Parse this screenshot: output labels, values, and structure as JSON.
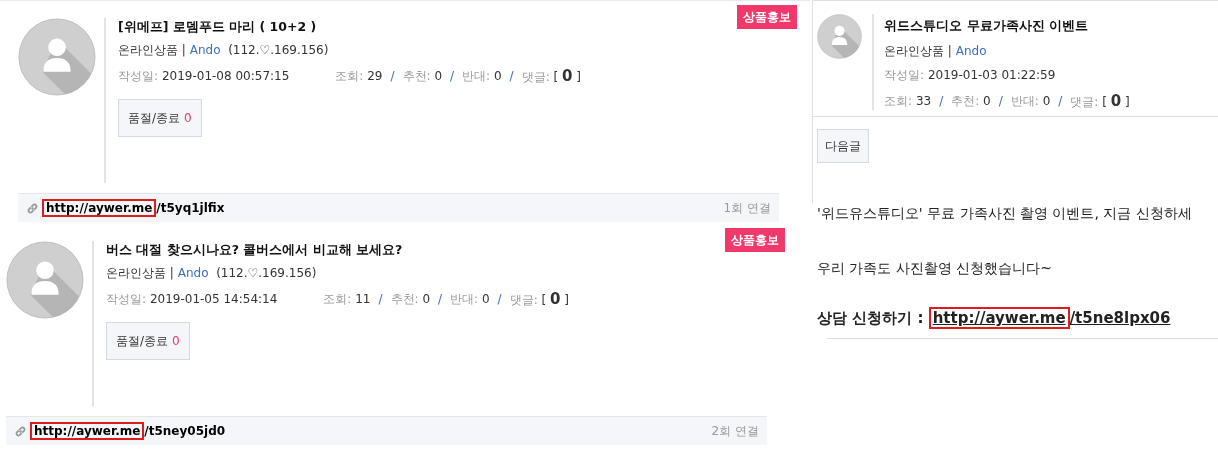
{
  "posts": [
    {
      "title": "[위메프] 로뎀푸드 마리 ( 10+2 )",
      "badge": "상품홍보",
      "category": "온라인상품",
      "author": "Ando",
      "ip": "(112.♡.169.156)",
      "date_label": "작성일:",
      "date": "2019-01-08 00:57:15",
      "stats": [
        {
          "label": "조회:",
          "value": "29"
        },
        {
          "label": "추천:",
          "value": "0"
        },
        {
          "label": "반대:",
          "value": "0"
        }
      ],
      "comments_label": "댓글:",
      "comments": "0",
      "sep": "|",
      "stat_sep": "/",
      "open": "[",
      "close": "]",
      "soldout_label": "품절/종료",
      "soldout_count": "0",
      "link": {
        "highlight": "http://aywer.me",
        "rest": "/t5yq1jlfix"
      },
      "link_count": "1회 연결"
    },
    {
      "title": "버스 대절 찾으시나요? 콜버스에서 비교해 보세요?",
      "badge": "상품홍보",
      "category": "온라인상품",
      "author": "Ando",
      "ip": "(112.♡.169.156)",
      "date_label": "작성일:",
      "date": "2019-01-05 14:54:14",
      "stats": [
        {
          "label": "조회:",
          "value": "11"
        },
        {
          "label": "추천:",
          "value": "0"
        },
        {
          "label": "반대:",
          "value": "0"
        }
      ],
      "comments_label": "댓글:",
      "comments": "0",
      "sep": "|",
      "stat_sep": "/",
      "open": "[",
      "close": "]",
      "soldout_label": "품절/종료",
      "soldout_count": "0",
      "link": {
        "highlight": "http://aywer.me",
        "rest": "/t5ney05jd0"
      },
      "link_count": "2회 연결"
    }
  ],
  "side_post": {
    "title": "위드스튜디오 무료가족사진 이벤트",
    "category": "온라인상품",
    "author": "Ando",
    "date_label": "작성일:",
    "date": "2019-01-03 01:22:59",
    "stats": [
      {
        "label": "조회:",
        "value": "33"
      },
      {
        "label": "추천:",
        "value": "0"
      },
      {
        "label": "반대:",
        "value": "0"
      }
    ],
    "comments_label": "댓글:",
    "comments": "0",
    "sep": "|",
    "stat_sep": "/",
    "open": "[",
    "close": "]",
    "next_button": "다음글",
    "body": [
      "'위드유스튜디오' 무료 가족사진 촬영 이벤트, 지금 신청하세",
      "우리 가족도 사진촬영 신청했습니다~"
    ],
    "cta_label": "상담 신청하기 :",
    "link": {
      "highlight": "http://aywer.me",
      "rest": "/t5ne8lpx06"
    }
  }
}
